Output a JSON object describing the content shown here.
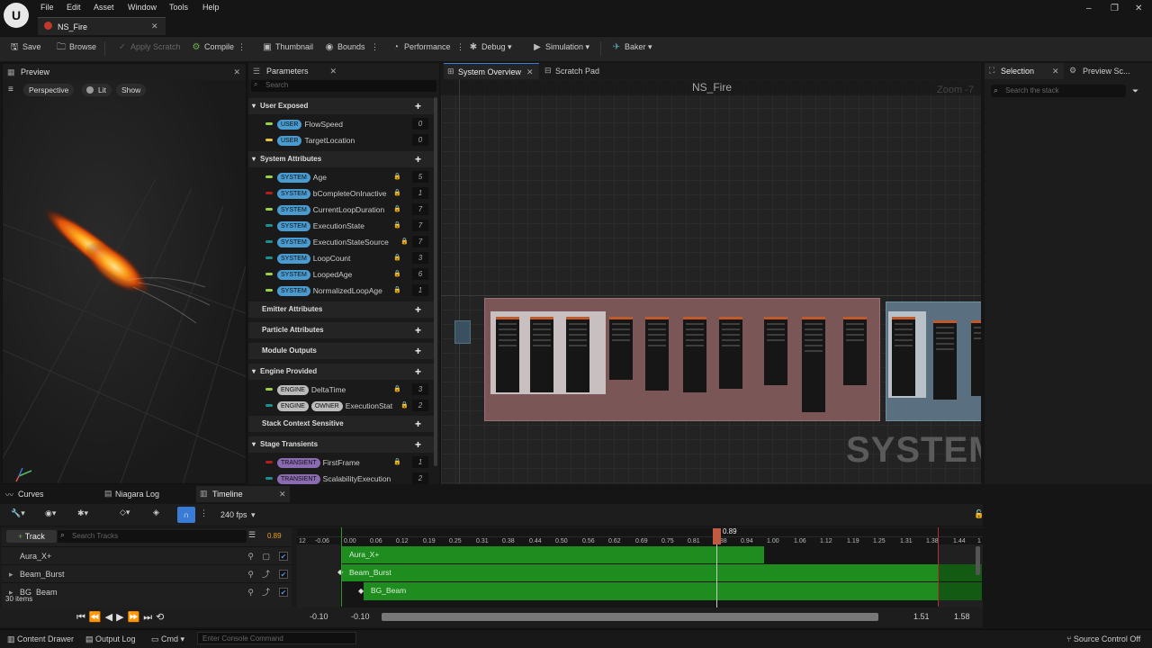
{
  "menubar": {
    "items": [
      "File",
      "Edit",
      "Asset",
      "Window",
      "Tools",
      "Help"
    ]
  },
  "asset_tab": {
    "title": "NS_Fire"
  },
  "toolbar": {
    "save": "Save",
    "browse": "Browse",
    "apply_scratch": "Apply Scratch",
    "compile": "Compile",
    "thumbnail": "Thumbnail",
    "bounds": "Bounds",
    "performance": "Performance",
    "debug": "Debug",
    "simulation": "Simulation",
    "baker": "Baker"
  },
  "preview": {
    "tab": "Preview",
    "perspective": "Perspective",
    "lit": "Lit",
    "show": "Show"
  },
  "parameters": {
    "tab": "Parameters",
    "search_placeholder": "Search",
    "user_exposed": "User Exposed",
    "user_rows": [
      {
        "tag": "USER",
        "name": "FlowSpeed",
        "count": "0"
      },
      {
        "tag": "USER",
        "name": "TargetLocation",
        "count": "0"
      }
    ],
    "system_attributes": "System Attributes",
    "system_rows": [
      {
        "tag": "SYSTEM",
        "name": "Age",
        "count": "5"
      },
      {
        "tag": "SYSTEM",
        "name": "bCompleteOnInactive",
        "count": "1"
      },
      {
        "tag": "SYSTEM",
        "name": "CurrentLoopDuration",
        "count": "7"
      },
      {
        "tag": "SYSTEM",
        "name": "ExecutionState",
        "count": "7"
      },
      {
        "tag": "SYSTEM",
        "name": "ExecutionStateSource",
        "count": "7"
      },
      {
        "tag": "SYSTEM",
        "name": "LoopCount",
        "count": "3"
      },
      {
        "tag": "SYSTEM",
        "name": "LoopedAge",
        "count": "6"
      },
      {
        "tag": "SYSTEM",
        "name": "NormalizedLoopAge",
        "count": "1"
      }
    ],
    "emitter_attributes": "Emitter Attributes",
    "particle_attributes": "Particle Attributes",
    "module_outputs": "Module Outputs",
    "engine_provided": "Engine Provided",
    "engine_rows": [
      {
        "tag": "ENGINE",
        "name": "DeltaTime",
        "count": "3"
      },
      {
        "tag": "ENGINE",
        "tag2": "OWNER",
        "name": "ExecutionStat",
        "count": "2"
      }
    ],
    "stack_context": "Stack Context Sensitive",
    "stage_transients": "Stage Transients",
    "transient_rows": [
      {
        "tag": "TRANSIENT",
        "name": "FirstFrame",
        "count": "1"
      },
      {
        "tag": "TRANSIENT",
        "name": "ScalabilityExecution",
        "count": "2"
      }
    ]
  },
  "graph": {
    "tab_overview": "System Overview",
    "tab_scratch": "Scratch Pad",
    "title": "NS_Fire",
    "zoom": "Zoom -7",
    "watermark": "SYSTEM"
  },
  "right": {
    "tab_selection": "Selection",
    "tab_preview": "Preview Sc...",
    "search_placeholder": "Search the stack"
  },
  "bottom_tabs": {
    "curves": "Curves",
    "log": "Niagara Log",
    "timeline": "Timeline"
  },
  "sequencer": {
    "fps": "240 fps",
    "current_time": "0.89",
    "track_button": "Track",
    "search_placeholder": "Search Tracks",
    "items_count": "30 items",
    "tracks": [
      {
        "name": "Aura_X+"
      },
      {
        "name": "Beam_Burst"
      },
      {
        "name": "BG_Beam"
      }
    ],
    "ticks": [
      "12",
      "-0.06",
      "0.00",
      "0.06",
      "0.12",
      "0.19",
      "0.25",
      "0.31",
      "0.38",
      "0.44",
      "0.50",
      "0.56",
      "0.62",
      "0.69",
      "0.75",
      "0.81",
      "0.88",
      "0.94",
      "1.00",
      "1.06",
      "1.12",
      "1.19",
      "1.25",
      "1.31",
      "1.38",
      "1.44",
      "1"
    ],
    "range_start": "-0.10",
    "view_start": "-0.10",
    "view_end": "1.51",
    "range_end": "1.58"
  },
  "statusbar": {
    "content_drawer": "Content Drawer",
    "output_log": "Output Log",
    "cmd": "Cmd",
    "console_placeholder": "Enter Console Command",
    "source_control": "Source Control Off"
  }
}
